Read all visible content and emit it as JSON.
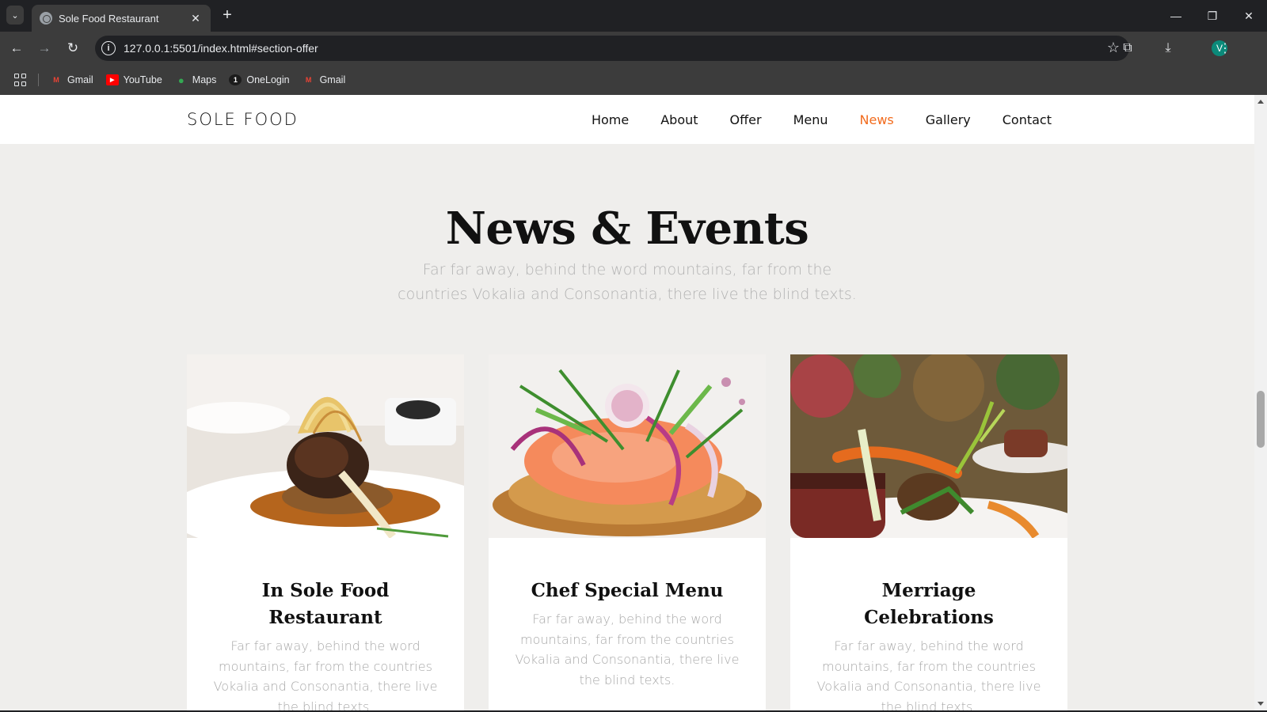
{
  "browser": {
    "tab_title": "Sole Food Restaurant",
    "url": "127.0.0.1:5501/index.html#section-offer",
    "profile_initial": "V",
    "bookmarks": [
      {
        "label": "Gmail",
        "icon": "gmail-icon"
      },
      {
        "label": "YouTube",
        "icon": "youtube-icon"
      },
      {
        "label": "Maps",
        "icon": "maps-icon"
      },
      {
        "label": "OneLogin",
        "icon": "onelogin-icon"
      },
      {
        "label": "Gmail",
        "icon": "gmail-icon"
      }
    ]
  },
  "site": {
    "brand": "SOLE FOOD",
    "nav": [
      {
        "label": "Home",
        "active": false
      },
      {
        "label": "About",
        "active": false
      },
      {
        "label": "Offer",
        "active": false
      },
      {
        "label": "Menu",
        "active": false
      },
      {
        "label": "News",
        "active": true
      },
      {
        "label": "Gallery",
        "active": false
      },
      {
        "label": "Contact",
        "active": false
      }
    ],
    "accent_color": "#f26b1d"
  },
  "section": {
    "title": "News & Events",
    "subtitle": "Far far away, behind the word mountains, far from the countries Vokalia and Consonantia, there live the blind texts."
  },
  "cards": [
    {
      "title": "In Sole Food Restaurant",
      "text": "Far far away, behind the word mountains, far from the countries Vokalia and Consonantia, there live the blind texts."
    },
    {
      "title": "Chef Special Menu",
      "text": "Far far away, behind the word mountains, far from the countries Vokalia and Consonantia, there live the blind texts."
    },
    {
      "title": "Merriage Celebrations",
      "text": "Far far away, behind the word mountains, far from the countries Vokalia and Consonantia, there live the blind texts."
    }
  ]
}
